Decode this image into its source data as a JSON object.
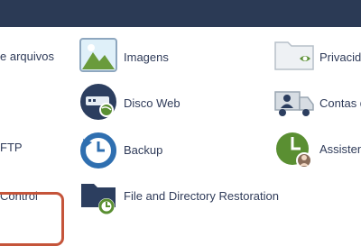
{
  "window": {
    "background": "#ffffff",
    "header_color": "#2b3a55"
  },
  "colors": {
    "accent_blue": "#2f6fb0",
    "text": "#2f3b59",
    "highlight": "#c5543a",
    "green": "#5a8f32"
  },
  "columns": [
    {
      "items": [
        {
          "label": "e arquivos"
        },
        {
          "label": "FTP"
        },
        {
          "label": "Control",
          "highlighted": true
        }
      ]
    },
    {
      "items": [
        {
          "label": "Imagens",
          "icon": "images-icon"
        },
        {
          "label": "Disco Web",
          "icon": "web-disk-icon"
        },
        {
          "label": "Backup",
          "icon": "backup-icon"
        },
        {
          "label": "File and Directory Restoration",
          "icon": "folder-restore-icon"
        }
      ]
    },
    {
      "items": [
        {
          "label": "Privacida",
          "icon": "folder-privacy-icon"
        },
        {
          "label": "Contas de",
          "icon": "user-truck-icon"
        },
        {
          "label": "Assisten",
          "icon": "backup-wizard-icon"
        }
      ]
    }
  ]
}
